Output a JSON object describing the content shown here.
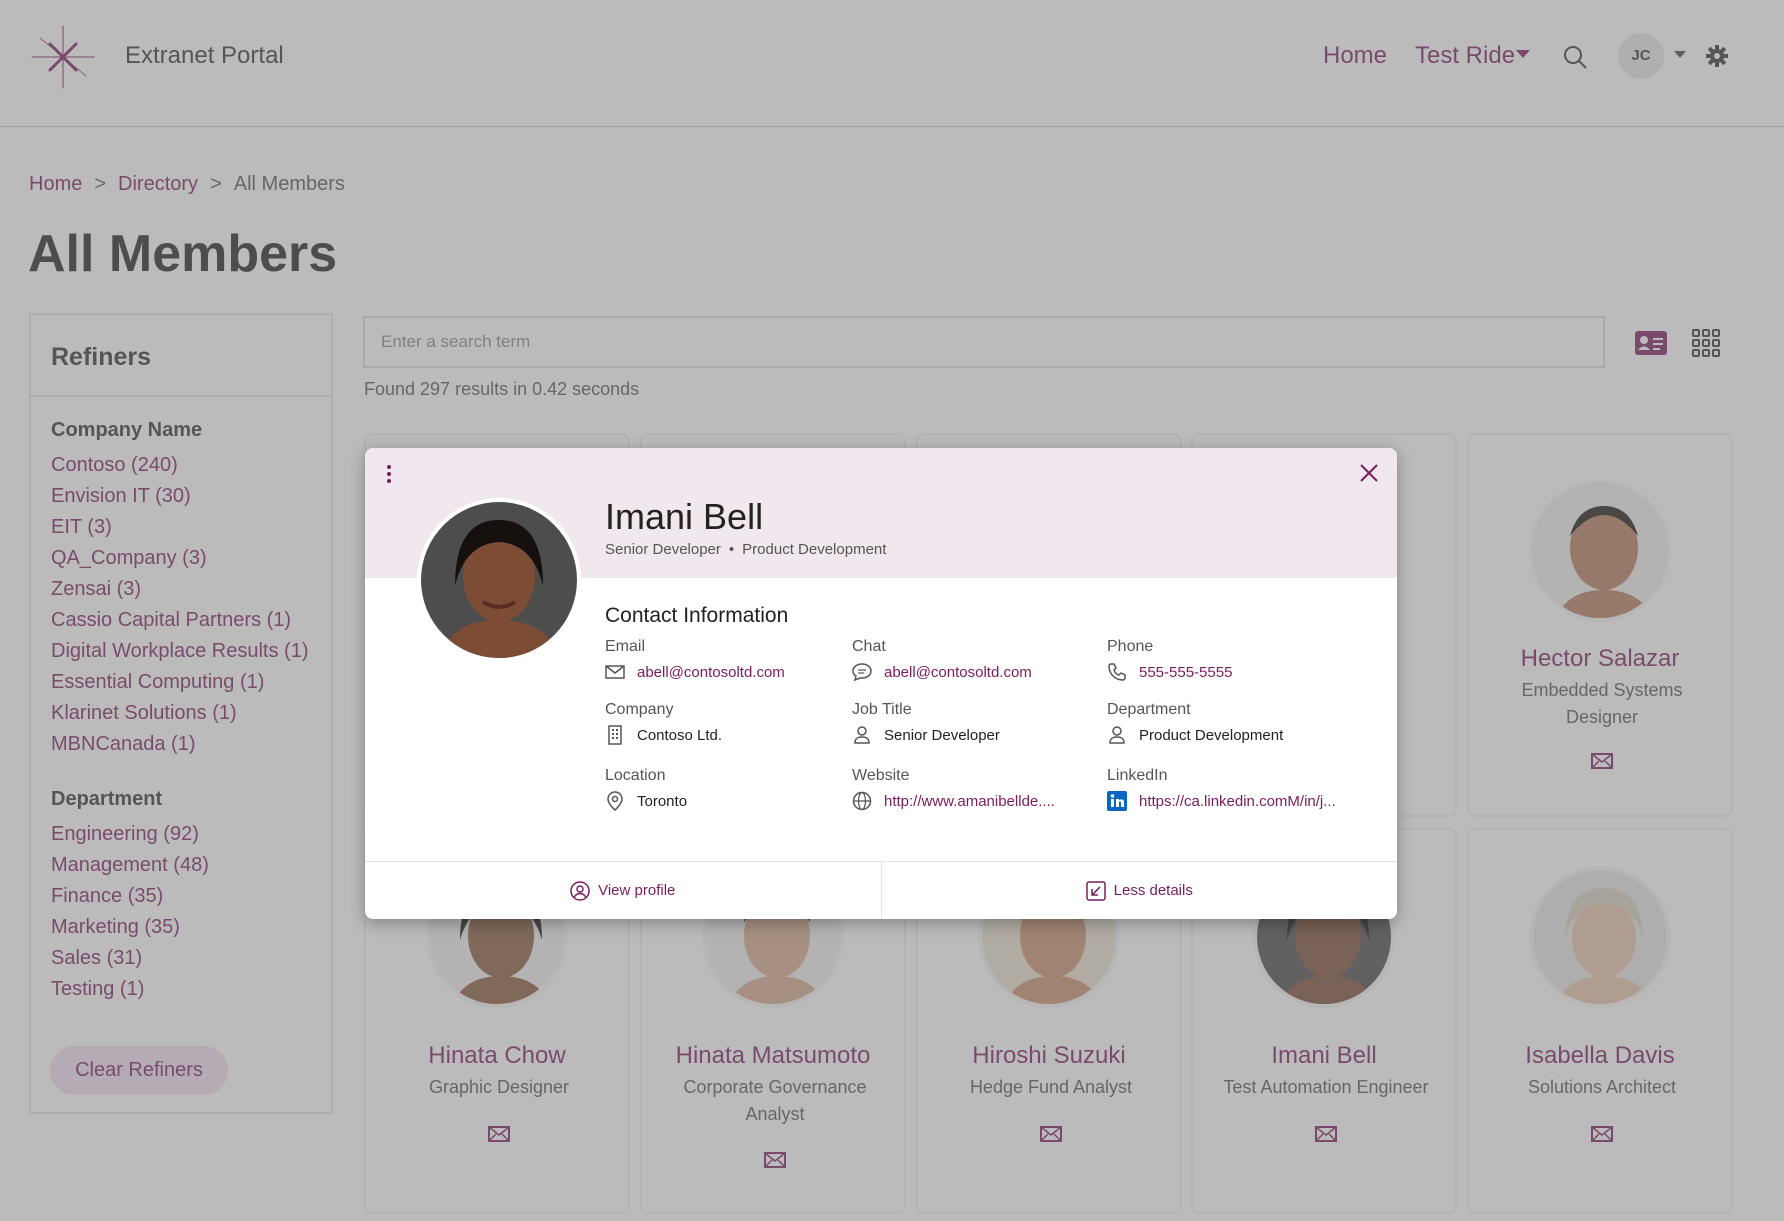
{
  "header": {
    "site_title": "Extranet Portal",
    "nav_home": "Home",
    "nav_test_ride": "Test Ride",
    "user_initials": "JC"
  },
  "breadcrumb": {
    "home": "Home",
    "sep1": ">",
    "directory": "Directory",
    "sep2": ">",
    "current": "All Members"
  },
  "page_title": "All Members",
  "refiners": {
    "heading": "Refiners",
    "company_heading": "Company Name",
    "companies": [
      "Contoso (240)",
      "Envision IT (30)",
      "EIT (3)",
      "QA_Company (3)",
      "Zensai (3)",
      "Cassio Capital Partners (1)",
      "Digital Workplace Results (1)",
      "Essential Computing (1)",
      "Klarinet Solutions (1)",
      "MBNCanada (1)"
    ],
    "department_heading": "Department",
    "departments": [
      "Engineering (92)",
      "Management (48)",
      "Finance (35)",
      "Marketing (35)",
      "Sales (31)",
      "Testing (1)"
    ],
    "clear_label": "Clear Refiners"
  },
  "search": {
    "placeholder": "Enter a search term",
    "results_text": "Found 297 results in 0.42 seconds"
  },
  "cards": [
    {
      "name": "Hector Salazar",
      "title": "Embedded Systems Designer"
    },
    {
      "name": "Hinata Chow",
      "title": "Graphic Designer"
    },
    {
      "name": "Hinata Matsumoto",
      "title": "Corporate Governance Analyst"
    },
    {
      "name": "Hiroshi Suzuki",
      "title": "Hedge Fund Analyst"
    },
    {
      "name": "Imani Bell",
      "title": "Test Automation Engineer"
    },
    {
      "name": "Isabella Davis",
      "title": "Solutions Architect"
    }
  ],
  "modal": {
    "name": "Imani Bell",
    "job": "Senior Developer",
    "bullet": "•",
    "department": "Product Development",
    "section_title": "Contact Information",
    "fields": {
      "email_label": "Email",
      "email_value": "abell@contosoltd.com",
      "chat_label": "Chat",
      "chat_value": "abell@contosoltd.com",
      "phone_label": "Phone",
      "phone_value": "555-555-5555",
      "company_label": "Company",
      "company_value": "Contoso Ltd.",
      "jobtitle_label": "Job Title",
      "jobtitle_value": "Senior Developer",
      "department_label": "Department",
      "department_value": "Product Development",
      "location_label": "Location",
      "location_value": "Toronto",
      "website_label": "Website",
      "website_value": "http://www.amanibellde....",
      "linkedin_label": "LinkedIn",
      "linkedin_value": "https://ca.linkedin.comM/in/j..."
    },
    "view_profile": "View profile",
    "less_details": "Less details"
  },
  "colors": {
    "accent": "#7a1d5e",
    "band": "#f1e7ef",
    "clear_button": "#f1dff0",
    "linkedin": "#0a66c2"
  }
}
